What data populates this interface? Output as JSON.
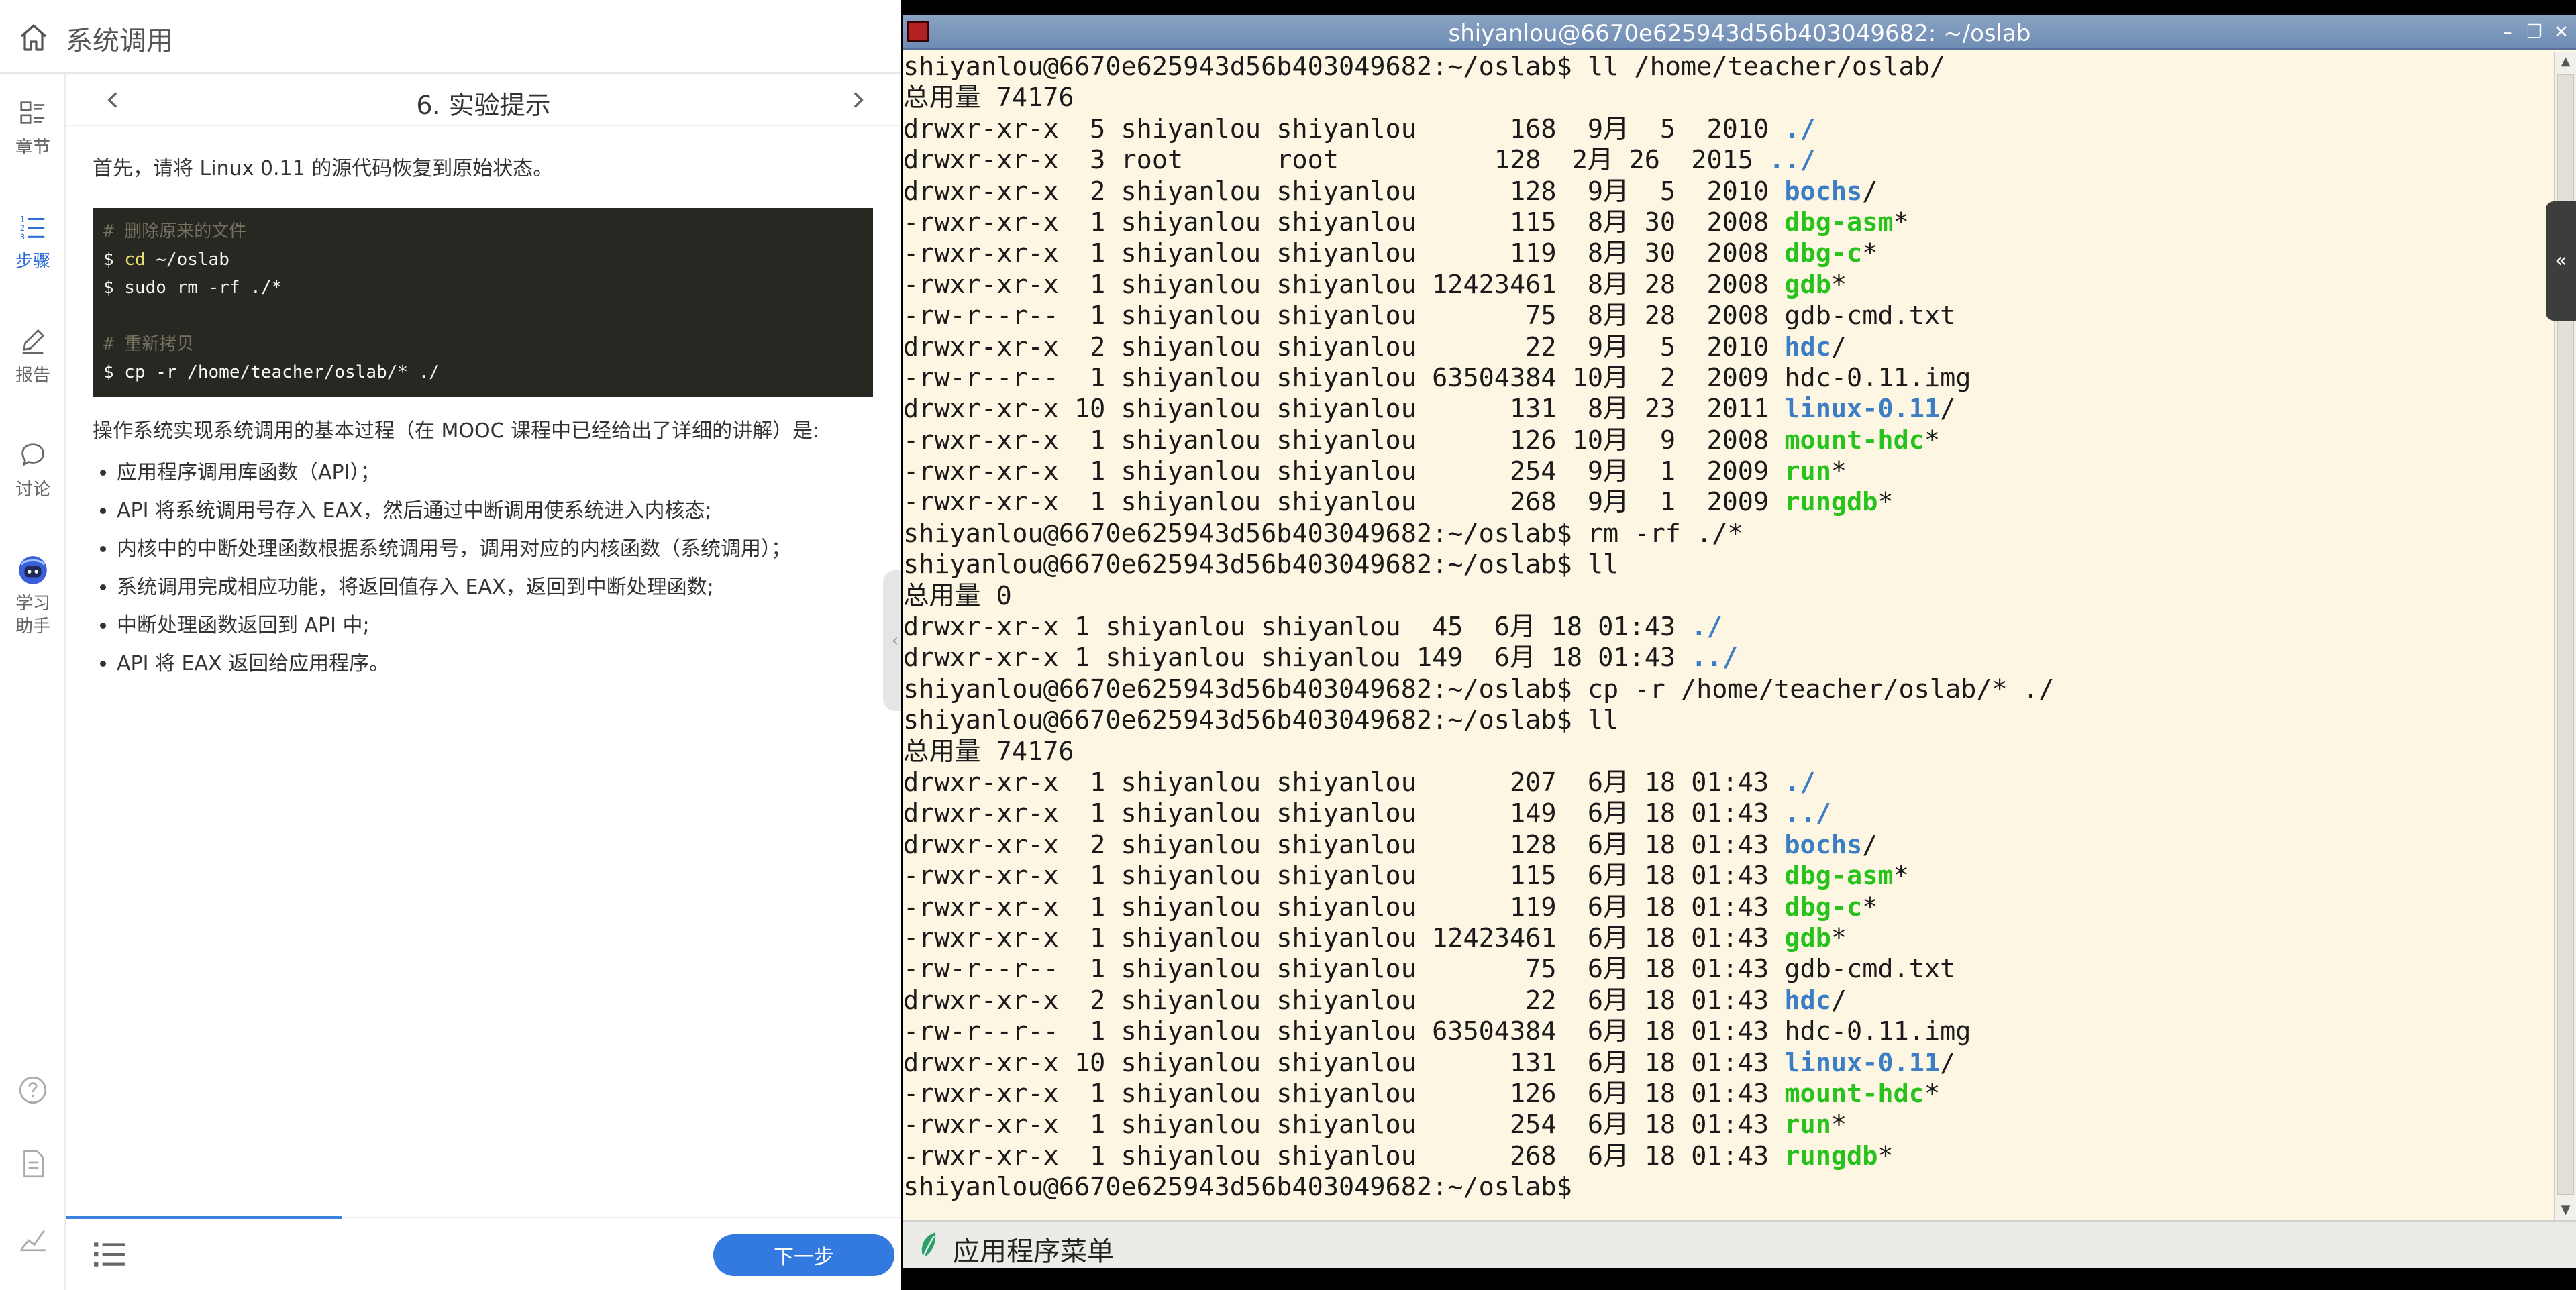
{
  "app": {
    "title": "系统调用"
  },
  "rail": {
    "items": [
      {
        "label": "章节",
        "icon": "chapters-icon"
      },
      {
        "label": "步骤",
        "icon": "steps-icon",
        "active": true
      },
      {
        "label": "报告",
        "icon": "report-icon"
      },
      {
        "label": "讨论",
        "icon": "discussion-icon"
      },
      {
        "label": "学习\n助手",
        "label_line1": "学习",
        "label_line2": "助手",
        "icon": "assistant-robot-icon"
      }
    ],
    "bottom_icons": [
      "help-icon",
      "document-icon",
      "stats-icon"
    ]
  },
  "step": {
    "title": "6. 实验提示"
  },
  "article": {
    "intro": "首先，请将 Linux 0.11 的源代码恢复到原始状态。",
    "code": {
      "comment1": "# 删除原来的文件",
      "line1_prompt": "$ ",
      "line1_cmd": "cd",
      "line1_rest": " ~/oslab",
      "line2": "$ sudo rm -rf ./*",
      "comment2": "# 重新拷贝",
      "line3": "$ cp -r /home/teacher/oslab/* ./"
    },
    "desc": "操作系统实现系统调用的基本过程（在 MOOC 课程中已经给出了详细的讲解）是:",
    "steps": [
      "应用程序调用库函数（API）；",
      "API 将系统调用号存入 EAX，然后通过中断调用使系统进入内核态;",
      "内核中的中断处理函数根据系统调用号，调用对应的内核函数（系统调用）；",
      "系统调用完成相应功能，将返回值存入 EAX，返回到中断处理函数;",
      "中断处理函数返回到 API 中;",
      "API 将 EAX 返回给应用程序。"
    ]
  },
  "bottom": {
    "next_label": "下一步",
    "progress": 0.33
  },
  "collapse_handle": "‹",
  "terminal": {
    "window_title": "shiyanlou@6670e625943d56b403049682: ~/oslab",
    "buttons": {
      "minimize": "–",
      "maximize": "❐",
      "close": "✕"
    },
    "side_tab": "«",
    "colors": {
      "background": "#fdf6e3",
      "dir": "#3b7ec6",
      "exe": "#27c21c"
    },
    "lines": [
      [
        {
          "t": "shiyanlou@6670e625943d56b403049682:~/oslab$ ll /home/teacher/oslab/"
        }
      ],
      [
        {
          "t": "总用量 74176"
        }
      ],
      [
        {
          "t": "drwxr-xr-x  5 shiyanlou shiyanlou      168  9月  5  2010 "
        },
        {
          "t": "./",
          "c": "dir"
        }
      ],
      [
        {
          "t": "drwxr-xr-x  3 root      root          128  2月 26  2015 "
        },
        {
          "t": "../",
          "c": "dir"
        }
      ],
      [
        {
          "t": "drwxr-xr-x  2 shiyanlou shiyanlou      128  9月  5  2010 "
        },
        {
          "t": "bochs",
          "c": "dir"
        },
        {
          "t": "/"
        }
      ],
      [
        {
          "t": "-rwxr-xr-x  1 shiyanlou shiyanlou      115  8月 30  2008 "
        },
        {
          "t": "dbg-asm",
          "c": "exe"
        },
        {
          "t": "*"
        }
      ],
      [
        {
          "t": "-rwxr-xr-x  1 shiyanlou shiyanlou      119  8月 30  2008 "
        },
        {
          "t": "dbg-c",
          "c": "exe"
        },
        {
          "t": "*"
        }
      ],
      [
        {
          "t": "-rwxr-xr-x  1 shiyanlou shiyanlou 12423461  8月 28  2008 "
        },
        {
          "t": "gdb",
          "c": "exe"
        },
        {
          "t": "*"
        }
      ],
      [
        {
          "t": "-rw-r--r--  1 shiyanlou shiyanlou       75  8月 28  2008 gdb-cmd.txt"
        }
      ],
      [
        {
          "t": "drwxr-xr-x  2 shiyanlou shiyanlou       22  9月  5  2010 "
        },
        {
          "t": "hdc",
          "c": "dir"
        },
        {
          "t": "/"
        }
      ],
      [
        {
          "t": "-rw-r--r--  1 shiyanlou shiyanlou 63504384 10月  2  2009 hdc-0.11.img"
        }
      ],
      [
        {
          "t": "drwxr-xr-x 10 shiyanlou shiyanlou      131  8月 23  2011 "
        },
        {
          "t": "linux-0.11",
          "c": "dir"
        },
        {
          "t": "/"
        }
      ],
      [
        {
          "t": "-rwxr-xr-x  1 shiyanlou shiyanlou      126 10月  9  2008 "
        },
        {
          "t": "mount-hdc",
          "c": "exe"
        },
        {
          "t": "*"
        }
      ],
      [
        {
          "t": "-rwxr-xr-x  1 shiyanlou shiyanlou      254  9月  1  2009 "
        },
        {
          "t": "run",
          "c": "exe"
        },
        {
          "t": "*"
        }
      ],
      [
        {
          "t": "-rwxr-xr-x  1 shiyanlou shiyanlou      268  9月  1  2009 "
        },
        {
          "t": "rungdb",
          "c": "exe"
        },
        {
          "t": "*"
        }
      ],
      [
        {
          "t": "shiyanlou@6670e625943d56b403049682:~/oslab$ rm -rf ./*"
        }
      ],
      [
        {
          "t": "shiyanlou@6670e625943d56b403049682:~/oslab$ ll"
        }
      ],
      [
        {
          "t": "总用量 0"
        }
      ],
      [
        {
          "t": "drwxr-xr-x 1 shiyanlou shiyanlou  45  6月 18 01:43 "
        },
        {
          "t": "./",
          "c": "dir"
        }
      ],
      [
        {
          "t": "drwxr-xr-x 1 shiyanlou shiyanlou 149  6月 18 01:43 "
        },
        {
          "t": "../",
          "c": "dir"
        }
      ],
      [
        {
          "t": "shiyanlou@6670e625943d56b403049682:~/oslab$ cp -r /home/teacher/oslab/* ./"
        }
      ],
      [
        {
          "t": "shiyanlou@6670e625943d56b403049682:~/oslab$ ll"
        }
      ],
      [
        {
          "t": "总用量 74176"
        }
      ],
      [
        {
          "t": "drwxr-xr-x  1 shiyanlou shiyanlou      207  6月 18 01:43 "
        },
        {
          "t": "./",
          "c": "dir"
        }
      ],
      [
        {
          "t": "drwxr-xr-x  1 shiyanlou shiyanlou      149  6月 18 01:43 "
        },
        {
          "t": "../",
          "c": "dir"
        }
      ],
      [
        {
          "t": "drwxr-xr-x  2 shiyanlou shiyanlou      128  6月 18 01:43 "
        },
        {
          "t": "bochs",
          "c": "dir"
        },
        {
          "t": "/"
        }
      ],
      [
        {
          "t": "-rwxr-xr-x  1 shiyanlou shiyanlou      115  6月 18 01:43 "
        },
        {
          "t": "dbg-asm",
          "c": "exe"
        },
        {
          "t": "*"
        }
      ],
      [
        {
          "t": "-rwxr-xr-x  1 shiyanlou shiyanlou      119  6月 18 01:43 "
        },
        {
          "t": "dbg-c",
          "c": "exe"
        },
        {
          "t": "*"
        }
      ],
      [
        {
          "t": "-rwxr-xr-x  1 shiyanlou shiyanlou 12423461  6月 18 01:43 "
        },
        {
          "t": "gdb",
          "c": "exe"
        },
        {
          "t": "*"
        }
      ],
      [
        {
          "t": "-rw-r--r--  1 shiyanlou shiyanlou       75  6月 18 01:43 gdb-cmd.txt"
        }
      ],
      [
        {
          "t": "drwxr-xr-x  2 shiyanlou shiyanlou       22  6月 18 01:43 "
        },
        {
          "t": "hdc",
          "c": "dir"
        },
        {
          "t": "/"
        }
      ],
      [
        {
          "t": "-rw-r--r--  1 shiyanlou shiyanlou 63504384  6月 18 01:43 hdc-0.11.img"
        }
      ],
      [
        {
          "t": "drwxr-xr-x 10 shiyanlou shiyanlou      131  6月 18 01:43 "
        },
        {
          "t": "linux-0.11",
          "c": "dir"
        },
        {
          "t": "/"
        }
      ],
      [
        {
          "t": "-rwxr-xr-x  1 shiyanlou shiyanlou      126  6月 18 01:43 "
        },
        {
          "t": "mount-hdc",
          "c": "exe"
        },
        {
          "t": "*"
        }
      ],
      [
        {
          "t": "-rwxr-xr-x  1 shiyanlou shiyanlou      254  6月 18 01:43 "
        },
        {
          "t": "run",
          "c": "exe"
        },
        {
          "t": "*"
        }
      ],
      [
        {
          "t": "-rwxr-xr-x  1 shiyanlou shiyanlou      268  6月 18 01:43 "
        },
        {
          "t": "rungdb",
          "c": "exe"
        },
        {
          "t": "*"
        }
      ],
      [
        {
          "t": "shiyanlou@6670e625943d56b403049682:~/oslab$"
        }
      ]
    ]
  },
  "taskbar": {
    "menu_label": "应用程序菜单",
    "menu_icon": "app-menu-leaf-icon"
  }
}
